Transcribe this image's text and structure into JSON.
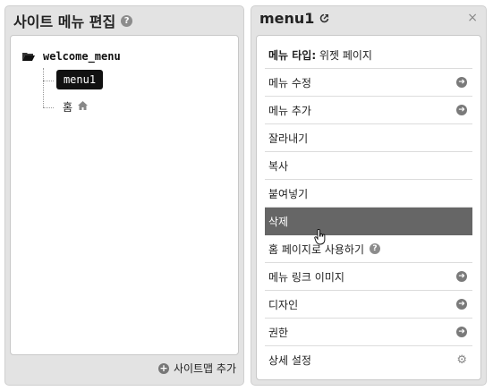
{
  "left_panel": {
    "title": "사이트 메뉴 편집",
    "help": "?",
    "tree": {
      "root_label": "welcome_menu",
      "selected_label": "menu1",
      "home_label": "홈"
    },
    "sitemap_add_label": "사이트맵 추가"
  },
  "right_panel": {
    "title": "menu1",
    "close": "×",
    "menu_type_label": "메뉴 타입:",
    "menu_type_value": " 위젯 페이지",
    "items": [
      {
        "label": "메뉴 수정",
        "icon": "arrow-right-icon"
      },
      {
        "label": "메뉴 추가",
        "icon": "arrow-right-icon"
      },
      {
        "label": "잘라내기"
      },
      {
        "label": "복사"
      },
      {
        "label": "붙여넣기"
      },
      {
        "label": "삭제"
      },
      {
        "label": "홈 페이지로 사용하기",
        "icon": "help-icon"
      },
      {
        "label": "메뉴 링크 이미지",
        "icon": "arrow-right-icon"
      },
      {
        "label": "디자인",
        "icon": "arrow-right-icon"
      },
      {
        "label": "권한",
        "icon": "arrow-right-icon"
      },
      {
        "label": "상세 설정",
        "icon": "gear-icon"
      }
    ]
  },
  "colors": {
    "panel_bg": "#e3e3e3",
    "selected_node_bg": "#111111",
    "active_item_bg": "#666666"
  }
}
